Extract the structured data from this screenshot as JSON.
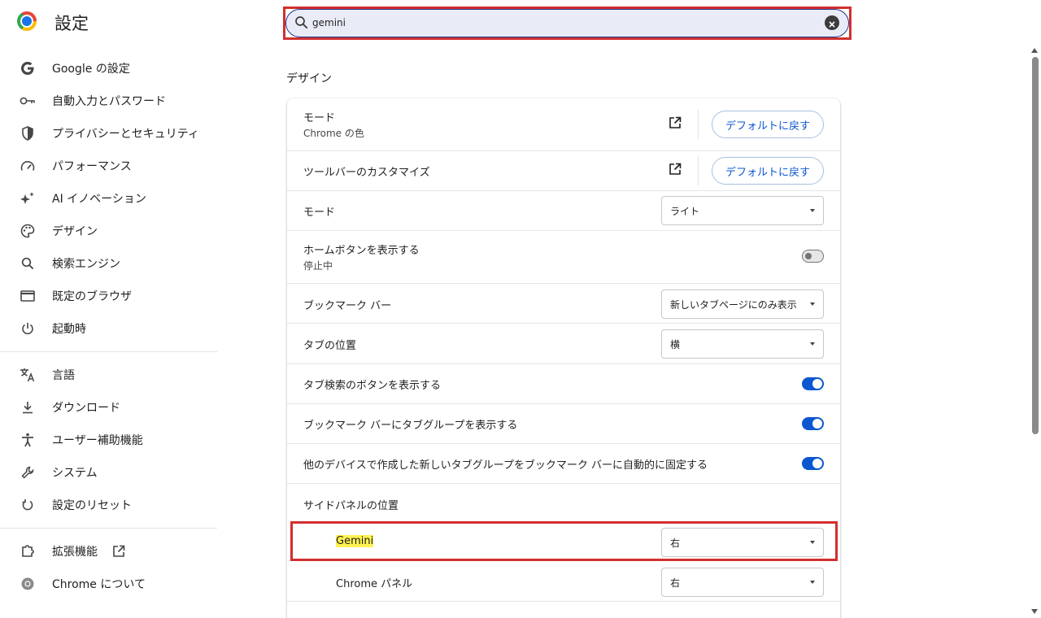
{
  "app": {
    "title": "設定"
  },
  "sidebar": {
    "items": [
      {
        "label": "Google の設定",
        "icon": "google-icon"
      },
      {
        "label": "自動入力とパスワード",
        "icon": "key-icon"
      },
      {
        "label": "プライバシーとセキュリティ",
        "icon": "shield-icon"
      },
      {
        "label": "パフォーマンス",
        "icon": "speedometer-icon"
      },
      {
        "label": "AI イノベーション",
        "icon": "sparkle-icon"
      },
      {
        "label": "デザイン",
        "icon": "palette-icon"
      },
      {
        "label": "検索エンジン",
        "icon": "search-icon"
      },
      {
        "label": "既定のブラウザ",
        "icon": "browser-window-icon"
      },
      {
        "label": "起動時",
        "icon": "power-icon"
      },
      {
        "label": "言語",
        "icon": "translate-icon"
      },
      {
        "label": "ダウンロード",
        "icon": "download-icon"
      },
      {
        "label": "ユーザー補助機能",
        "icon": "accessibility-icon"
      },
      {
        "label": "システム",
        "icon": "wrench-icon"
      },
      {
        "label": "設定のリセット",
        "icon": "reset-icon"
      },
      {
        "label": "拡張機能",
        "icon": "puzzle-icon"
      },
      {
        "label": "Chrome について",
        "icon": "chrome-icon"
      }
    ]
  },
  "search": {
    "value": "gemini"
  },
  "section": {
    "title": "デザイン",
    "mode_row": {
      "label": "モード",
      "sub": "Chrome の色",
      "button": "デフォルトに戻す"
    },
    "toolbar_row": {
      "label": "ツールバーのカスタマイズ",
      "button": "デフォルトに戻す"
    },
    "mode_select_row": {
      "label": "モード",
      "value": "ライト"
    },
    "home_button_row": {
      "label": "ホームボタンを表示する",
      "sub": "停止中",
      "enabled": false
    },
    "bookmark_bar_row": {
      "label": "ブックマーク バー",
      "value": "新しいタブページにのみ表示"
    },
    "tab_position_row": {
      "label": "タブの位置",
      "value": "横"
    },
    "tab_search_row": {
      "label": "タブ検索のボタンを表示する",
      "enabled": true
    },
    "tab_groups_row": {
      "label": "ブックマーク バーにタブグループを表示する",
      "enabled": true
    },
    "auto_pin_row": {
      "label": "他のデバイスで作成した新しいタブグループをブックマーク バーに自動的に固定する",
      "enabled": true
    },
    "side_panel": {
      "label": "サイドパネルの位置",
      "gemini": {
        "label": "Gemini",
        "value": "右"
      },
      "chrome_panel": {
        "label": "Chrome パネル",
        "value": "右"
      }
    }
  },
  "colors": {
    "accent": "#0b57d0",
    "highlight_border": "#d32f2f",
    "search_match": "#fff250"
  }
}
